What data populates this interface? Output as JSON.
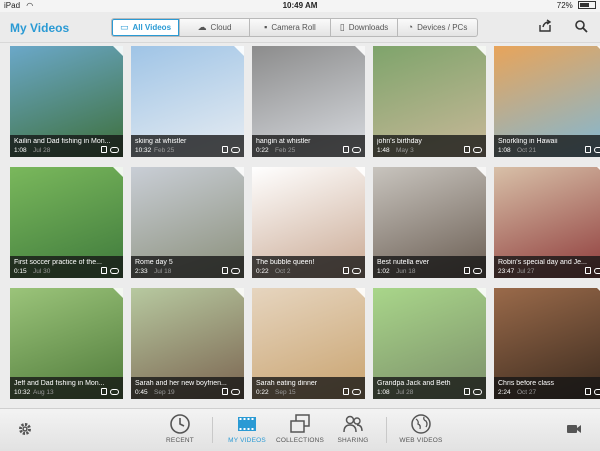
{
  "status_bar": {
    "device": "iPad",
    "time": "10:49 AM",
    "battery": "72%",
    "battery_level": 0.72
  },
  "header": {
    "title": "My Videos",
    "tabs": [
      {
        "label": "All Videos",
        "icon": "monitor-icon",
        "active": true
      },
      {
        "label": "Cloud",
        "icon": "cloud-icon",
        "active": false
      },
      {
        "label": "Camera Roll",
        "icon": "camera-icon",
        "active": false
      },
      {
        "label": "Downloads",
        "icon": "download-icon",
        "active": false
      },
      {
        "label": "Devices / PCs",
        "icon": "wifi-icon",
        "active": false
      }
    ]
  },
  "videos": [
    {
      "title": "Kailin and Dad fishing in Mon...",
      "duration": "1:08",
      "date": "Jul 28",
      "colors": [
        "#6ba8c9",
        "#3d6f3a"
      ]
    },
    {
      "title": "skiing at whistler",
      "duration": "10:32",
      "date": "Feb 25",
      "colors": [
        "#9fc4e6",
        "#e8edf2"
      ]
    },
    {
      "title": "hangin at whistler",
      "duration": "0:22",
      "date": "Feb 25",
      "colors": [
        "#8c8c8c",
        "#d8dbe0"
      ]
    },
    {
      "title": "john's birthday",
      "duration": "1:48",
      "date": "May 3",
      "colors": [
        "#7ea46b",
        "#c9b899"
      ]
    },
    {
      "title": "Snorkling in Hawaii",
      "duration": "1:08",
      "date": "Oct 21",
      "colors": [
        "#e8a45a",
        "#7fb8d6"
      ]
    },
    {
      "title": "First soccer practice of the...",
      "duration": "0:15",
      "date": "Jul 30",
      "colors": [
        "#7ab85c",
        "#3f7a3c"
      ]
    },
    {
      "title": "Rome day 5",
      "duration": "2:33",
      "date": "Jul 18",
      "colors": [
        "#c9ced6",
        "#8a8f7a"
      ]
    },
    {
      "title": "The bubble queen!",
      "duration": "0:22",
      "date": "Oct 2",
      "colors": [
        "#ffffff",
        "#c9a892"
      ]
    },
    {
      "title": "Best nutella ever",
      "duration": "1:02",
      "date": "Jun 18",
      "colors": [
        "#c8c4be",
        "#6a5d52"
      ]
    },
    {
      "title": "Robin's special day and Je...",
      "duration": "23:47",
      "date": "Jul 27",
      "colors": [
        "#d8c0a8",
        "#8e3a3a"
      ]
    },
    {
      "title": "Jeff and Dad fishing in Mon...",
      "duration": "10:32",
      "date": "Aug 13",
      "colors": [
        "#9bc47a",
        "#4f7a3a"
      ]
    },
    {
      "title": "Sarah and her new boyfrien...",
      "duration": "0:45",
      "date": "Sep 19",
      "colors": [
        "#b7c9a0",
        "#7b6450"
      ]
    },
    {
      "title": "Sarah eating dinner",
      "duration": "0:22",
      "date": "Sep 15",
      "colors": [
        "#e6d5bf",
        "#c9a36f"
      ]
    },
    {
      "title": "Grandpa Jack and Beth",
      "duration": "1:08",
      "date": "Jul 28",
      "colors": [
        "#a9d68a",
        "#7c8f6a"
      ]
    },
    {
      "title": "Chris before class",
      "duration": "2:24",
      "date": "Oct 27",
      "colors": [
        "#9a6a4a",
        "#3a2a1e"
      ]
    }
  ],
  "nav": [
    {
      "label": "RECENT",
      "icon": "clock-icon",
      "active": false
    },
    {
      "label": "MY VIDEOS",
      "icon": "film-icon",
      "active": true
    },
    {
      "label": "COLLECTIONS",
      "icon": "collections-icon",
      "active": false
    },
    {
      "label": "SHARING",
      "icon": "sharing-icon",
      "active": false
    },
    {
      "label": "WEB VIDEOS",
      "icon": "globe-icon",
      "active": false
    }
  ],
  "colors": {
    "accent": "#2a9ad4",
    "header_bg": "#ebebeb",
    "caption_bg": "#141414"
  }
}
